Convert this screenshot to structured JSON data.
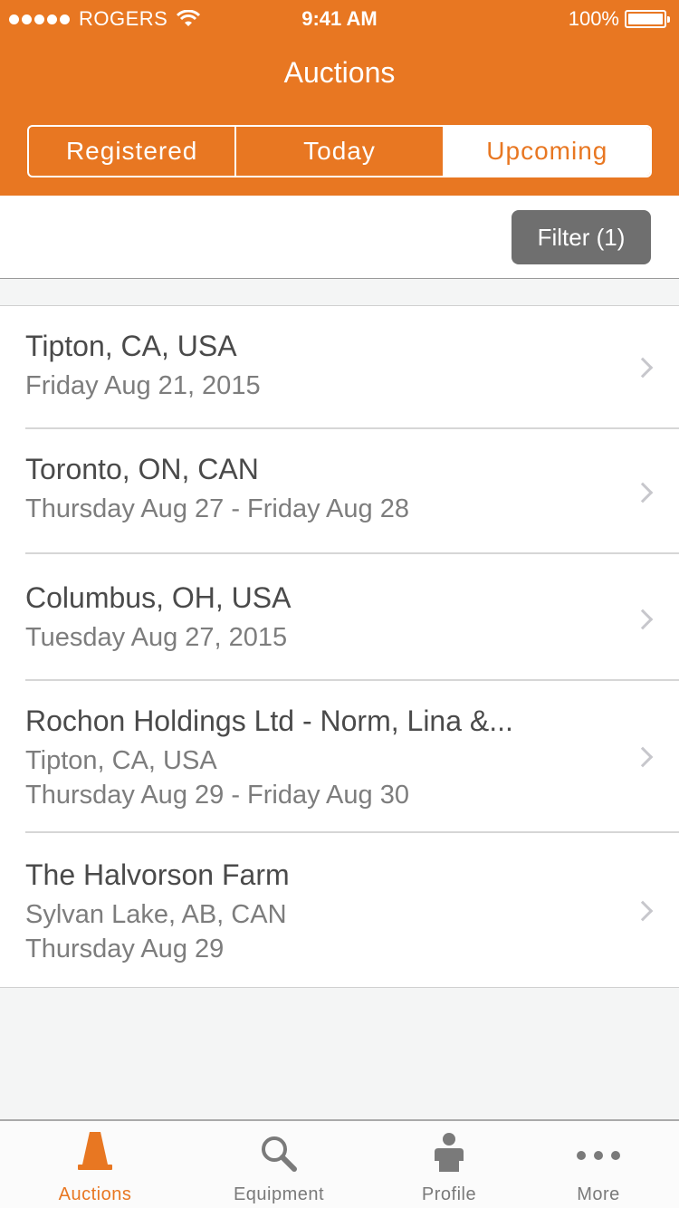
{
  "status_bar": {
    "carrier": "ROGERS",
    "time": "9:41 AM",
    "battery": "100%"
  },
  "nav": {
    "title": "Auctions"
  },
  "segments": [
    {
      "label": "Registered",
      "active": false
    },
    {
      "label": "Today",
      "active": false
    },
    {
      "label": "Upcoming",
      "active": true
    }
  ],
  "filter": {
    "label": "Filter (1)"
  },
  "auctions": [
    {
      "title": "Tipton, CA, USA",
      "lines": [
        "Friday Aug 21, 2015"
      ]
    },
    {
      "title": "Toronto, ON, CAN",
      "lines": [
        "Thursday Aug 27 - Friday Aug 28"
      ]
    },
    {
      "title": "Columbus, OH, USA",
      "lines": [
        "Tuesday Aug 27, 2015"
      ]
    },
    {
      "title": "Rochon Holdings Ltd - Norm, Lina &...",
      "lines": [
        "Tipton, CA, USA",
        "Thursday Aug 29 - Friday Aug 30"
      ]
    },
    {
      "title": "The Halvorson Farm",
      "lines": [
        "Sylvan Lake, AB, CAN",
        "Thursday Aug 29"
      ]
    }
  ],
  "tabbar": [
    {
      "label": "Auctions",
      "icon": "cone-icon",
      "active": true
    },
    {
      "label": "Equipment",
      "icon": "search-icon",
      "active": false
    },
    {
      "label": "Profile",
      "icon": "person-icon",
      "active": false
    },
    {
      "label": "More",
      "icon": "more-dots-icon",
      "active": false
    }
  ],
  "colors": {
    "brand": "#e87722",
    "filter_button": "#6f6f6f"
  }
}
